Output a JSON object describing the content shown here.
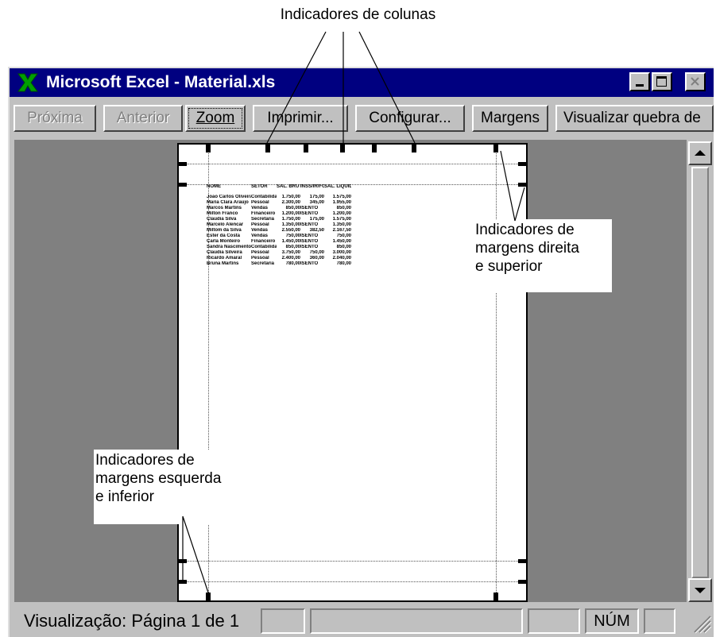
{
  "annotations": {
    "columns": "Indicadores de colunas",
    "right_top_margins": [
      "Indicadores de",
      "margens direita",
      "e superior"
    ],
    "left_bottom_margins": [
      "Indicadores de",
      "margens esquerda",
      "e inferior"
    ]
  },
  "window": {
    "app_icon": "excel-x-icon",
    "title": "Microsoft Excel - Material.xls",
    "controls": [
      "minimize-icon",
      "maximize-icon",
      "close-icon"
    ]
  },
  "toolbar": {
    "next": "Próxima",
    "previous": "Anterior",
    "zoom": "Zoom",
    "print": "Imprimir...",
    "setup": "Configurar...",
    "margins": "Margens",
    "page_break": "Visualizar quebra de"
  },
  "sheet": {
    "headers": [
      "NOME",
      "SETOR",
      "SAL. BRUTO",
      "INSS/IR/FGTS",
      "SAL. LÍQUIDO"
    ],
    "rows": [
      [
        "Joao Carlos Oliveira",
        "Contabilidade",
        "1.750,00",
        "175,00",
        "1.575,00"
      ],
      [
        "Maria Clara Araujo",
        "Pessoal",
        "2.300,00",
        "345,00",
        "1.955,00"
      ],
      [
        "Marcos Martins",
        "Vendas",
        "850,00",
        "ISENTO",
        "850,00"
      ],
      [
        "Milton Franco",
        "Financeiro",
        "1.200,00",
        "ISENTO",
        "1.200,00"
      ],
      [
        "Claudia Silva",
        "Secretaria",
        "1.750,00",
        "175,00",
        "1.575,00"
      ],
      [
        "Marcelo Alencar",
        "Pessoal",
        "1.350,00",
        "ISENTO",
        "1.350,00"
      ],
      [
        "Miltom da Silva",
        "Vendas",
        "2.550,00",
        "382,50",
        "2.167,50"
      ],
      [
        "Ester da Costa",
        "Vendas",
        "750,00",
        "ISENTO",
        "750,00"
      ],
      [
        "Carla Monteiro",
        "Financeiro",
        "1.450,00",
        "ISENTO",
        "1.450,00"
      ],
      [
        "Sandra Nascimento",
        "Contabilidade",
        "850,00",
        "ISENTO",
        "850,00"
      ],
      [
        "Claudia Silveira",
        "Pessoal",
        "3.750,00",
        "750,00",
        "3.000,00"
      ],
      [
        "Ricardo Amaral",
        "Pessoal",
        "2.400,00",
        "360,00",
        "2.040,00"
      ],
      [
        "Bruna Martins",
        "Secretaria",
        "780,00",
        "ISENTO",
        "780,00"
      ]
    ]
  },
  "status": {
    "text": "Visualização: Página 1 de 1",
    "num_indicator": "NÚM"
  },
  "colors": {
    "title_bar": "#000080",
    "face": "#c0c0c0",
    "workspace": "#808080",
    "page": "#ffffff"
  }
}
